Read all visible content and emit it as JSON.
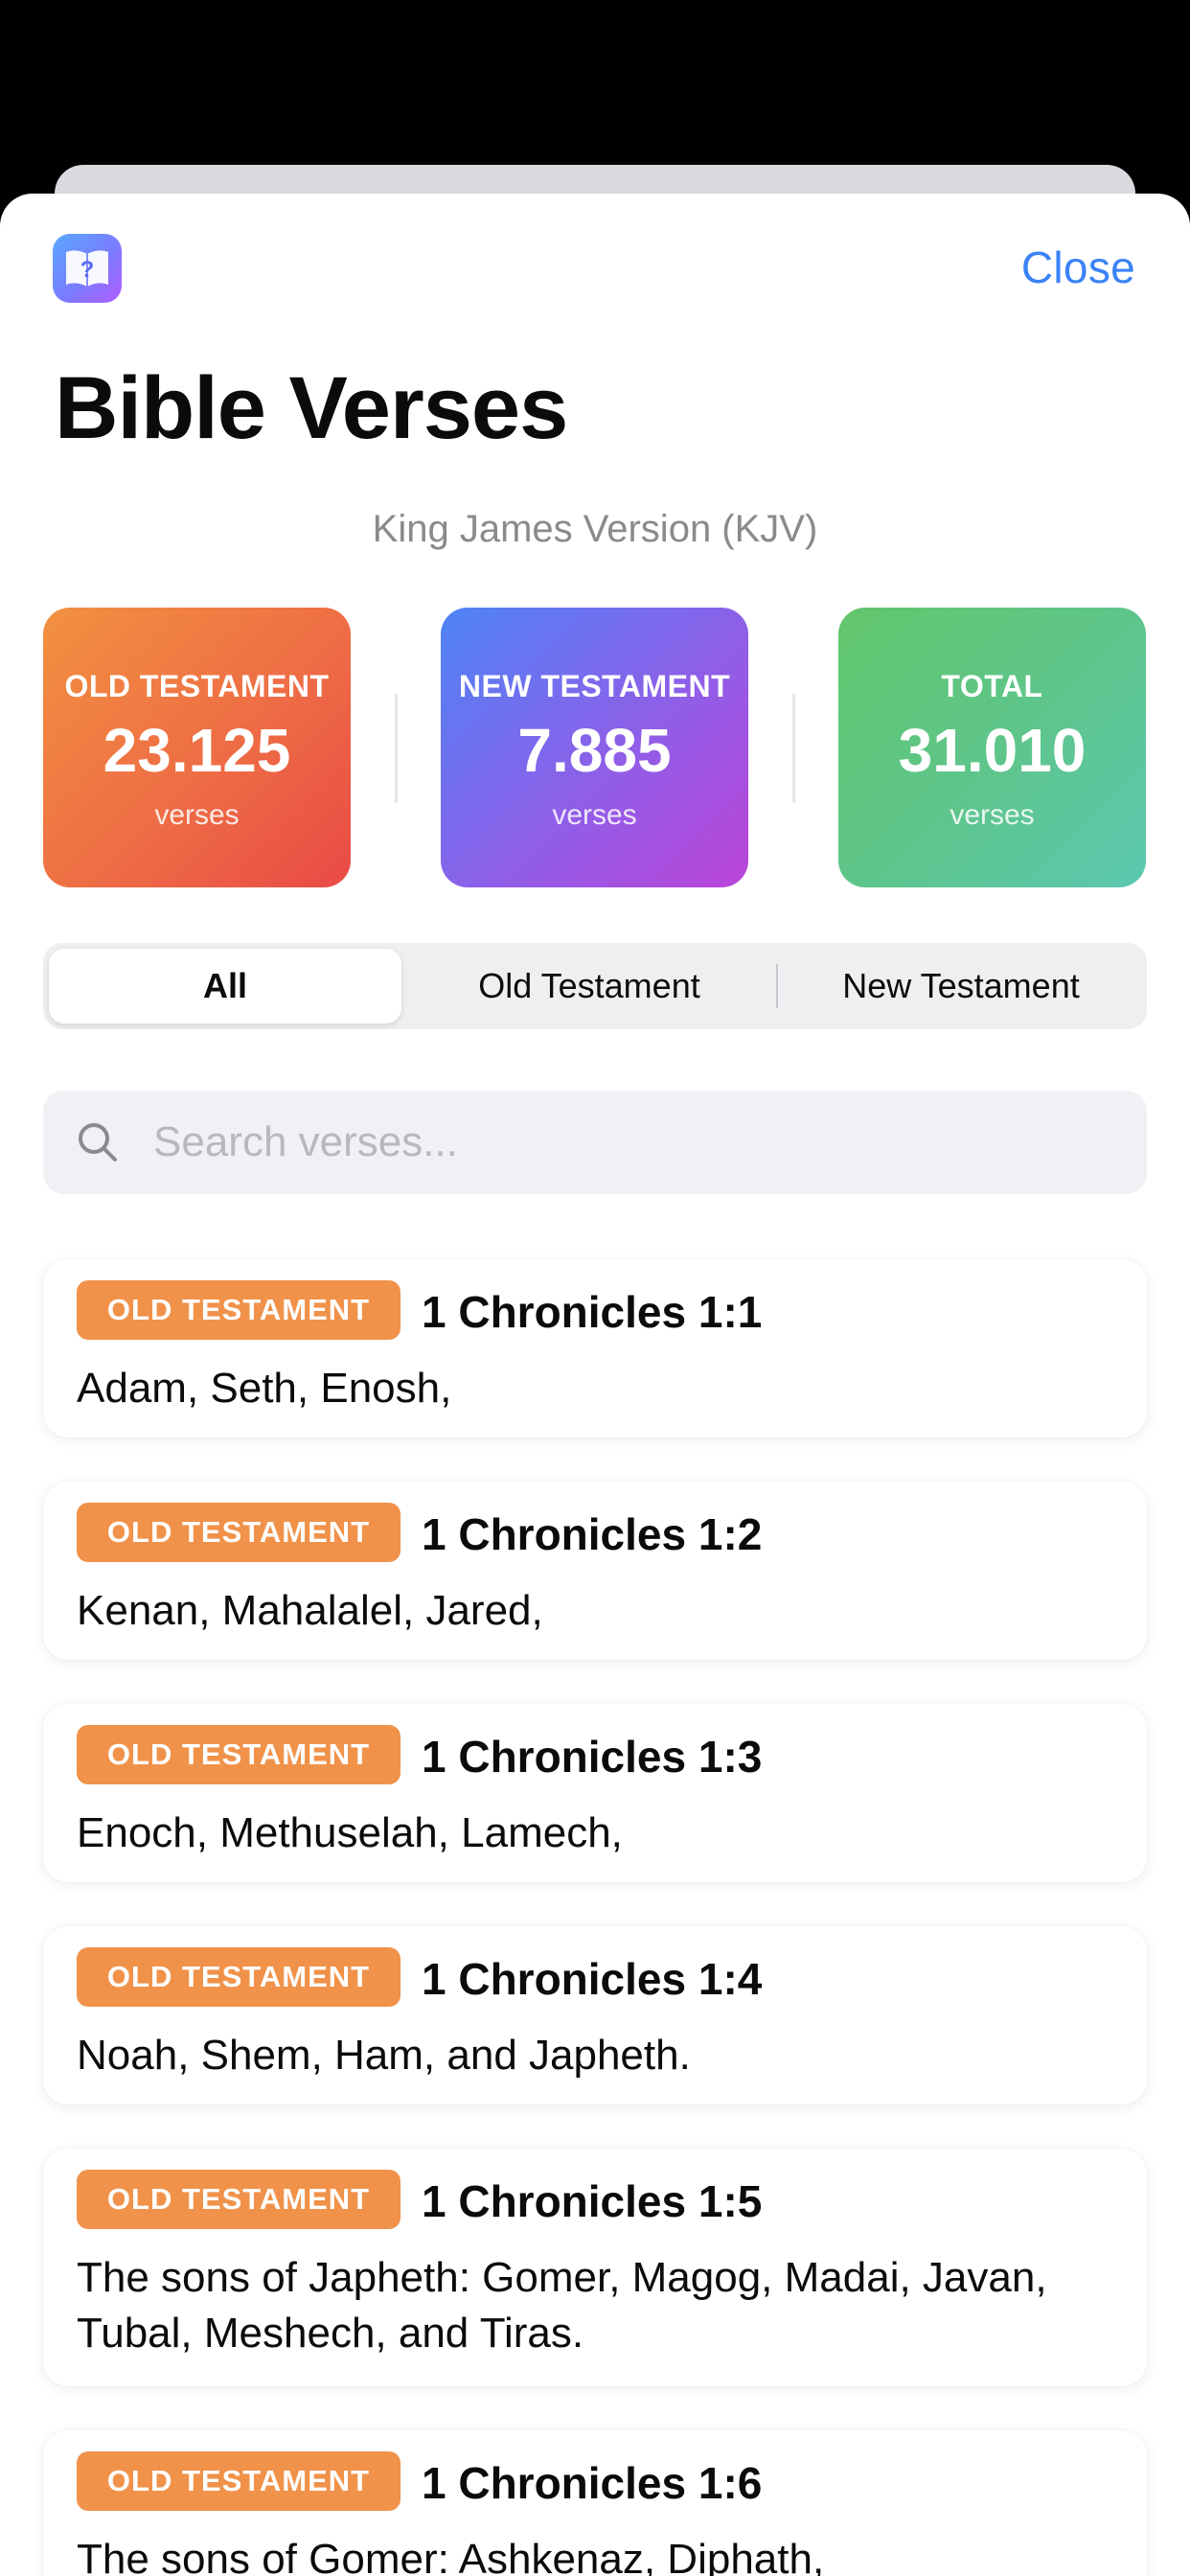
{
  "header": {
    "close_label": "Close",
    "title": "Bible Verses",
    "subtitle": "King James Version (KJV)"
  },
  "stats": [
    {
      "label": "OLD TESTAMENT",
      "value": "23.125",
      "unit": "verses"
    },
    {
      "label": "NEW TESTAMENT",
      "value": "7.885",
      "unit": "verses"
    },
    {
      "label": "TOTAL",
      "value": "31.010",
      "unit": "verses"
    }
  ],
  "filter": {
    "options": [
      "All",
      "Old Testament",
      "New Testament"
    ],
    "selected": "All"
  },
  "search": {
    "placeholder": "Search verses..."
  },
  "verses": [
    {
      "badge": "OLD TESTAMENT",
      "reference": "1 Chronicles 1:1",
      "text": "Adam, Seth, Enosh,"
    },
    {
      "badge": "OLD TESTAMENT",
      "reference": "1 Chronicles 1:2",
      "text": "Kenan, Mahalalel, Jared,"
    },
    {
      "badge": "OLD TESTAMENT",
      "reference": "1 Chronicles 1:3",
      "text": "Enoch, Methuselah, Lamech,"
    },
    {
      "badge": "OLD TESTAMENT",
      "reference": "1 Chronicles 1:4",
      "text": "Noah, Shem, Ham, and Japheth."
    },
    {
      "badge": "OLD TESTAMENT",
      "reference": "1 Chronicles 1:5",
      "text": "The sons of Japheth: Gomer, Magog, Madai, Javan, Tubal, Meshech, and Tiras."
    },
    {
      "badge": "OLD TESTAMENT",
      "reference": "1 Chronicles 1:6",
      "text": "The sons of Gomer: Ashkenaz, Diphath,"
    }
  ],
  "colors": {
    "accent": "#3b82f6",
    "badge_old": "#f0924a"
  }
}
